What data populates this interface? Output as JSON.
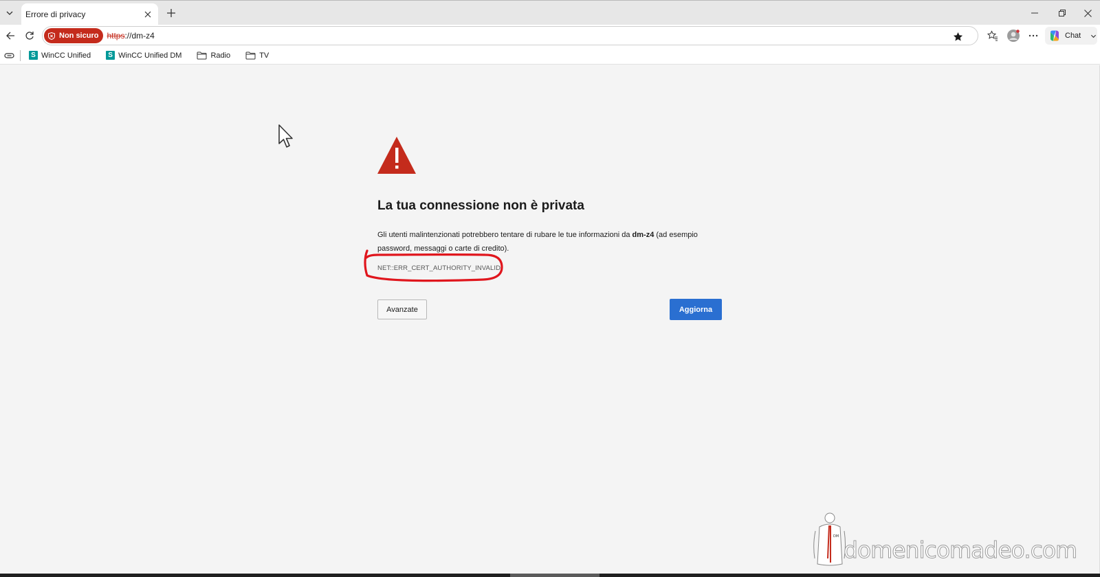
{
  "tab": {
    "title": "Errore di privacy"
  },
  "window": {
    "minimize": "−",
    "restore": "⧉",
    "close": "✕"
  },
  "addressbar": {
    "security_label": "Non sicuro",
    "url_scheme": "https",
    "url_rest": "://dm-z4"
  },
  "toolbar": {
    "chat_label": "Chat"
  },
  "favorites": [
    {
      "label": "WinCC Unified",
      "icon": "siemens-s-icon"
    },
    {
      "label": "WinCC Unified DM",
      "icon": "siemens-s-icon"
    },
    {
      "label": "Radio",
      "icon": "folder-icon"
    },
    {
      "label": "TV",
      "icon": "folder-icon"
    }
  ],
  "favorites_s_letter": "S",
  "error": {
    "title": "La tua connessione non è privata",
    "desc_before": "Gli utenti malintenzionati potrebbero tentare di rubare le tue informazioni da ",
    "host": "dm-z4",
    "desc_after": " (ad esempio password, messaggi o carte di credito).",
    "code": "NET::ERR_CERT_AUTHORITY_INVALID",
    "advanced_label": "Avanzate",
    "refresh_label": "Aggiorna"
  },
  "watermark": {
    "text": "domenicomadeo.com",
    "badge": "DM"
  },
  "colors": {
    "danger": "#c42b1c",
    "primary_button": "#2a6fd1",
    "annotation": "#e0161d",
    "siemens": "#009999"
  }
}
